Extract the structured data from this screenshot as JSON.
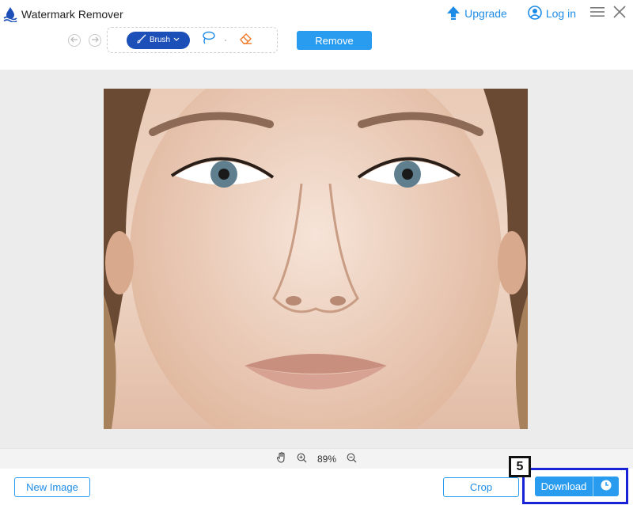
{
  "app": {
    "title": "Watermark Remover",
    "accent": "#2a9cf0",
    "brush_color": "#1c4fb8",
    "highlight_color": "#1a22d8"
  },
  "header": {
    "upgrade_label": "Upgrade",
    "login_label": "Log in",
    "icons": [
      "app-logo-icon",
      "upgrade-arrow-icon",
      "user-icon",
      "menu-icon",
      "close-icon"
    ]
  },
  "toolbar": {
    "undo_icon": "undo-icon",
    "redo_icon": "redo-icon",
    "brush_label": "Brush",
    "lasso_icon": "lasso-icon",
    "eraser_icon": "eraser-icon",
    "remove_label": "Remove"
  },
  "zoom": {
    "level": "89%",
    "icons": [
      "hand-icon",
      "zoom-in-icon",
      "zoom-out-icon"
    ]
  },
  "bottom": {
    "new_image_label": "New Image",
    "crop_label": "Crop",
    "download_label": "Download",
    "step_badge": "5"
  }
}
